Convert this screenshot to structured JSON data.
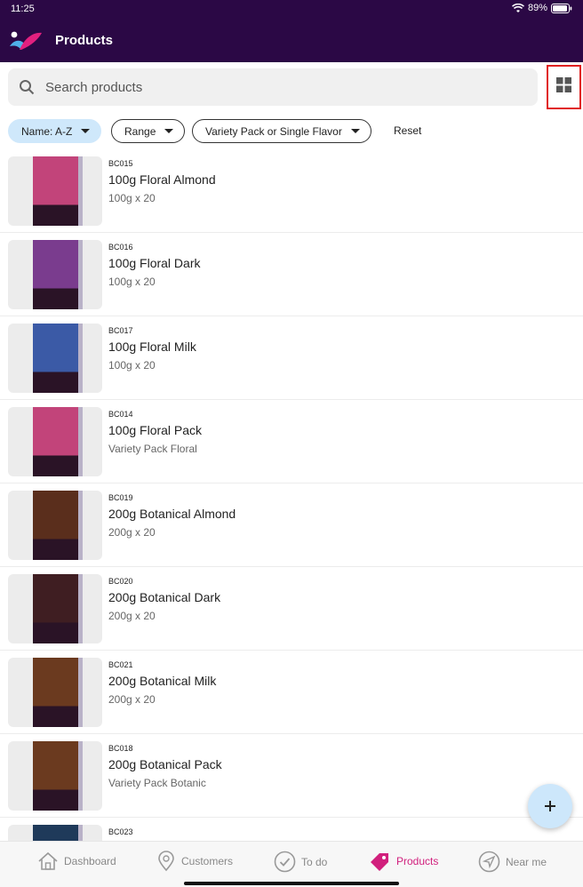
{
  "status_bar": {
    "time": "11:25",
    "battery": "89%"
  },
  "app": {
    "title": "Products"
  },
  "search": {
    "placeholder": "Search products"
  },
  "filters": {
    "sort_label": "Name: A-Z",
    "range_label": "Range",
    "variety_label": "Variety Pack or Single Flavor",
    "reset_label": "Reset"
  },
  "products": [
    {
      "code": "BC015",
      "name": "100g Floral Almond",
      "sub": "100g x 20",
      "color": "#c2447a"
    },
    {
      "code": "BC016",
      "name": "100g Floral Dark",
      "sub": "100g x 20",
      "color": "#7a3c8e"
    },
    {
      "code": "BC017",
      "name": "100g Floral Milk",
      "sub": "100g x 20",
      "color": "#3b5aa6"
    },
    {
      "code": "BC014",
      "name": "100g Floral Pack",
      "sub": "Variety Pack Floral",
      "color": "#c2447a"
    },
    {
      "code": "BC019",
      "name": "200g Botanical Almond",
      "sub": "200g x 20",
      "color": "#5a2e1c"
    },
    {
      "code": "BC020",
      "name": "200g Botanical Dark",
      "sub": "200g x 20",
      "color": "#3f1e22"
    },
    {
      "code": "BC021",
      "name": "200g Botanical Milk",
      "sub": "200g x 20",
      "color": "#6b3a1f"
    },
    {
      "code": "BC018",
      "name": "200g Botanical Pack",
      "sub": "Variety Pack Botanic",
      "color": "#6b3a1f"
    },
    {
      "code": "BC023",
      "name": "",
      "sub": "",
      "color": "#1f3a5a"
    }
  ],
  "nav": {
    "dashboard": "Dashboard",
    "customers": "Customers",
    "todo": "To do",
    "products": "Products",
    "near_me": "Near me"
  },
  "colors": {
    "appbar": "#2b0845",
    "accent": "#d1207d",
    "chip_active": "#cfe8fb",
    "highlight": "#e02020"
  }
}
